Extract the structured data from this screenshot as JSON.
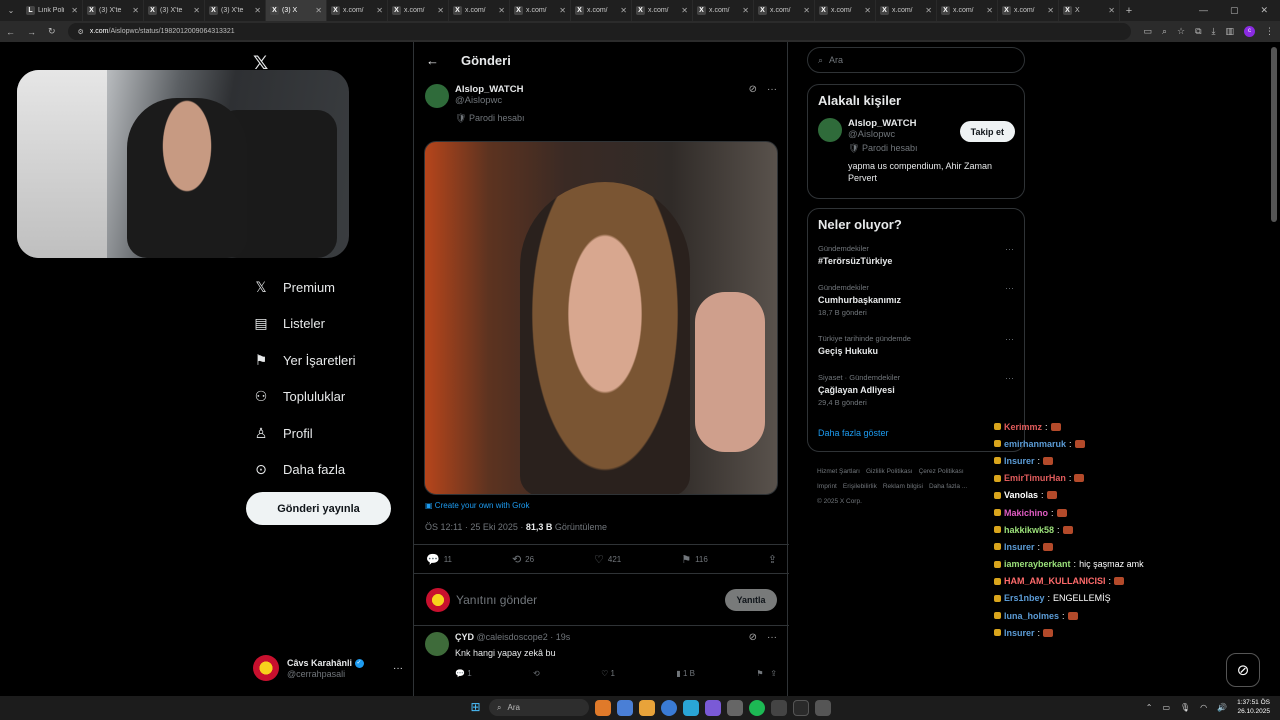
{
  "browser": {
    "tabs": [
      {
        "label": "Link Poli",
        "active": false,
        "fav": "L"
      },
      {
        "label": "(3) X'te",
        "active": false,
        "fav": "X"
      },
      {
        "label": "(3) X'te",
        "active": false,
        "fav": "X"
      },
      {
        "label": "(3) X'te",
        "active": false,
        "fav": "X"
      },
      {
        "label": "(3) X",
        "active": true,
        "fav": "X"
      },
      {
        "label": "x.com/",
        "active": false,
        "fav": "X"
      },
      {
        "label": "x.com/",
        "active": false,
        "fav": "X"
      },
      {
        "label": "x.com/",
        "active": false,
        "fav": "X"
      },
      {
        "label": "x.com/",
        "active": false,
        "fav": "X"
      },
      {
        "label": "x.com/",
        "active": false,
        "fav": "X"
      },
      {
        "label": "x.com/",
        "active": false,
        "fav": "X"
      },
      {
        "label": "x.com/",
        "active": false,
        "fav": "X"
      },
      {
        "label": "x.com/",
        "active": false,
        "fav": "X"
      },
      {
        "label": "x.com/",
        "active": false,
        "fav": "X"
      },
      {
        "label": "x.com/",
        "active": false,
        "fav": "X"
      },
      {
        "label": "x.com/",
        "active": false,
        "fav": "X"
      },
      {
        "label": "x.com/",
        "active": false,
        "fav": "X"
      },
      {
        "label": "X",
        "active": false,
        "fav": "X"
      }
    ],
    "url_domain": "x.com",
    "url_path": "/Aislopwc/status/1982012009064313321"
  },
  "nav": {
    "items": [
      {
        "label": "Premium",
        "icon": "x-logo-icon"
      },
      {
        "label": "Listeler",
        "icon": "list-icon"
      },
      {
        "label": "Yer İşaretleri",
        "icon": "bookmark-icon"
      },
      {
        "label": "Topluluklar",
        "icon": "people-icon"
      },
      {
        "label": "Profil",
        "icon": "person-icon"
      },
      {
        "label": "Daha fazla",
        "icon": "more-circle-icon"
      }
    ],
    "post_button": "Gönderi yayınla",
    "account": {
      "name": "Câvs Karahânli",
      "handle": "@cerrahpasali"
    }
  },
  "post": {
    "header_title": "Gönderi",
    "author_name": "AIslop_WATCH",
    "author_handle": "@Aislopwc",
    "badge": "Parodi hesabı",
    "grok_link": "Create your own with Grok",
    "time": "ÖS 12:11 · 25 Eki 2025 · ",
    "views": "81,3 B",
    "views_label": " Görüntüleme",
    "stats": {
      "replies": "11",
      "reposts": "26",
      "likes": "421",
      "bookmarks": "116"
    },
    "reply_placeholder": "Yanıtını gönder",
    "reply_button": "Yanıtla"
  },
  "reply": {
    "name": "ÇYD",
    "handle": "@caleisdoscope2",
    "time": "· 19s",
    "text": "Knk hangi yapay zekâ bu",
    "replies": "1",
    "likes": "1",
    "views": "1 B"
  },
  "sidebar": {
    "search_placeholder": "Ara",
    "related_title": "Alakalı kişiler",
    "related": {
      "name": "AIslop_WATCH",
      "handle": "@Aislopwc",
      "badge": "Parodi hesabı",
      "bio": "yapma us compendium, Ahir Zaman Pervert",
      "follow": "Takip et"
    },
    "trends_title": "Neler oluyor?",
    "trends": [
      {
        "context": "Gündemdekiler",
        "title": "#TerörsüzTürkiye",
        "count": ""
      },
      {
        "context": "Gündemdekiler",
        "title": "Cumhurbaşkanımız",
        "count": "18,7 B gönderi"
      },
      {
        "context": "Türkiye tarihinde gündemde",
        "title": "Geçiş Hukuku",
        "count": ""
      },
      {
        "context": "Siyaset · Gündemdekiler",
        "title": "Çağlayan Adliyesi",
        "count": "29,4 B gönderi"
      }
    ],
    "show_more": "Daha fazla göster",
    "footer": [
      "Hizmet Şartları",
      "Gizlilik Politikası",
      "Çerez Politikası",
      "Imprint",
      "Erişilebilirlik",
      "Reklam bilgisi",
      "Daha fazla ...",
      "© 2025 X Corp."
    ]
  },
  "chat": [
    {
      "user": "Kerimmz",
      "color": "#e05c5c",
      "text": ""
    },
    {
      "user": "emirhanmaruk",
      "color": "#5b9bd5",
      "text": ""
    },
    {
      "user": "Insurer",
      "color": "#5b9bd5",
      "text": ""
    },
    {
      "user": "EmirTimurHan",
      "color": "#e05c5c",
      "text": ""
    },
    {
      "user": "Vanolas",
      "color": "#ffffff",
      "text": ""
    },
    {
      "user": "Makichino",
      "color": "#e05cc2",
      "text": ""
    },
    {
      "user": "hakkikwk58",
      "color": "#9be07a",
      "text": ""
    },
    {
      "user": "Insurer",
      "color": "#5b9bd5",
      "text": ""
    },
    {
      "user": "iamerayberkant",
      "color": "#9be07a",
      "text": "hiç şaşmaz amk"
    },
    {
      "user": "HAM_AM_KULLANICISI",
      "color": "#ff6b6b",
      "text": ""
    },
    {
      "user": "Ers1nbey",
      "color": "#5b9bd5",
      "text": "ENGELLEMİŞ"
    },
    {
      "user": "luna_holmes",
      "color": "#5b9bd5",
      "text": ""
    },
    {
      "user": "Insurer",
      "color": "#5b9bd5",
      "text": ""
    }
  ],
  "taskbar": {
    "search": "Ara",
    "time": "1:37:51 ÖS",
    "date": "26.10.2025"
  }
}
